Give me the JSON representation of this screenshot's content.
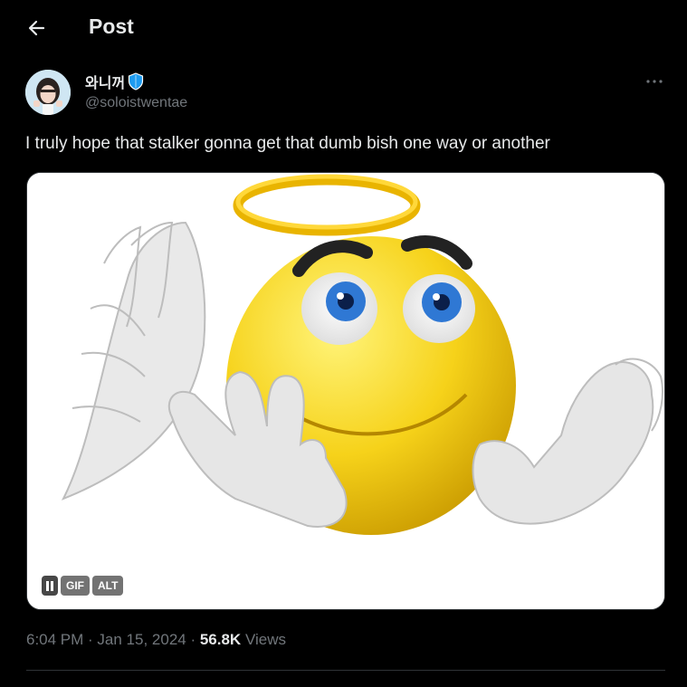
{
  "header": {
    "title": "Post"
  },
  "author": {
    "display_name": "와니꺼",
    "handle": "@soloistwentae",
    "verified_badge_icon": "blue-shield-icon"
  },
  "tweet": {
    "text": "I truly hope that stalker gonna get that dumb bish one way or another"
  },
  "media": {
    "type": "gif",
    "pause_icon": "pause-icon",
    "gif_label": "GIF",
    "alt_label": "ALT"
  },
  "meta": {
    "time": "6:04 PM",
    "sep1": " · ",
    "date": "Jan 15, 2024",
    "sep2": " · ",
    "views_count": "56.8K",
    "views_label": " Views"
  },
  "colors": {
    "background": "#000000",
    "text_primary": "#e7e9ea",
    "text_secondary": "#71767b",
    "divider": "#2f3336",
    "badge_blue": "#1d9bf0"
  }
}
